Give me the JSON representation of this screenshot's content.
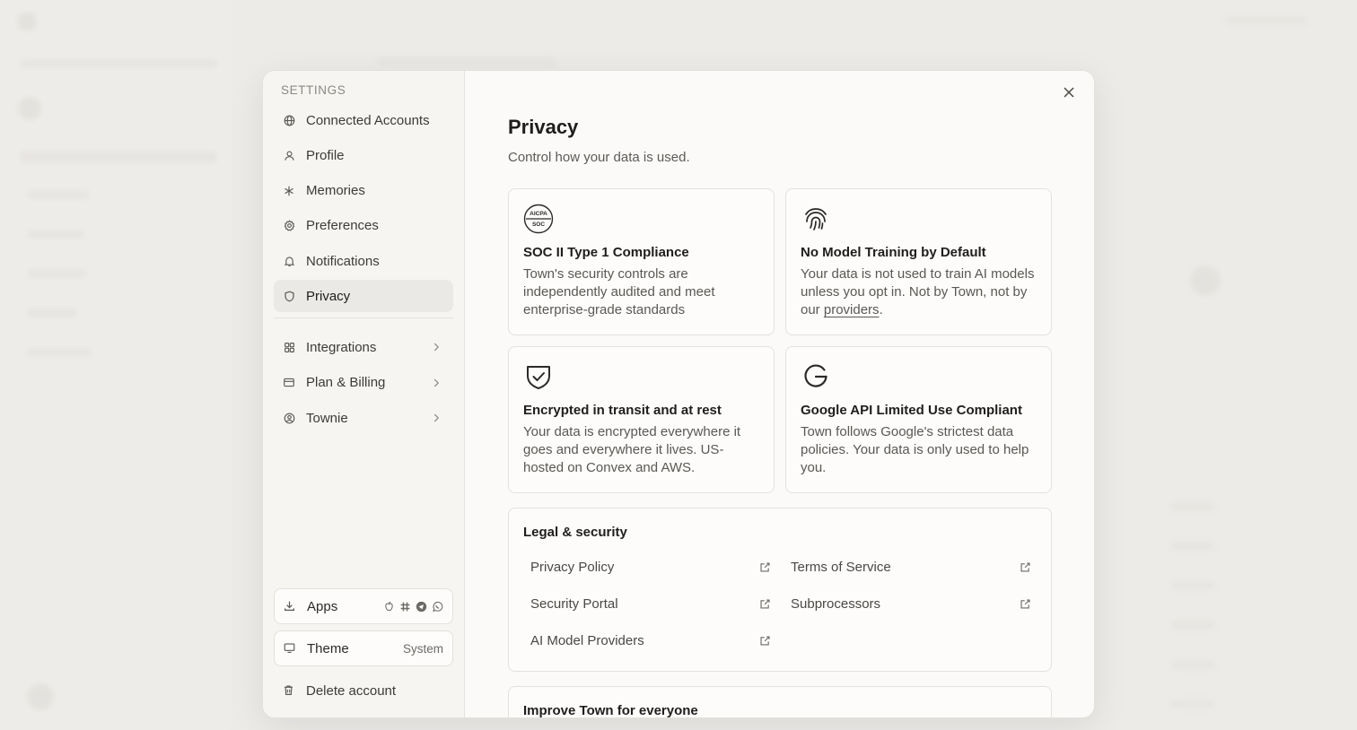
{
  "sidebar": {
    "heading": "SETTINGS",
    "items": [
      {
        "label": "Connected Accounts",
        "icon": "globe-icon"
      },
      {
        "label": "Profile",
        "icon": "user-icon"
      },
      {
        "label": "Memories",
        "icon": "asterisk-icon"
      },
      {
        "label": "Preferences",
        "icon": "gear-icon"
      },
      {
        "label": "Notifications",
        "icon": "bell-icon"
      },
      {
        "label": "Privacy",
        "icon": "shield-icon",
        "active": true
      }
    ],
    "expandable_items": [
      {
        "label": "Integrations",
        "icon": "grid-icon"
      },
      {
        "label": "Plan & Billing",
        "icon": "credit-card-icon"
      },
      {
        "label": "Townie",
        "icon": "user-circle-icon"
      }
    ],
    "apps_label": "Apps",
    "theme_label": "Theme",
    "theme_value": "System",
    "delete_label": "Delete account"
  },
  "main": {
    "title": "Privacy",
    "subtitle": "Control how your data is used.",
    "cards": [
      {
        "title": "SOC II Type 1 Compliance",
        "description": "Town's security controls are independently audited and meet enterprise-grade standards",
        "icon": "aicpa-soc-badge-icon",
        "badge_top": "AICPA",
        "badge_bottom": "SOC"
      },
      {
        "title": "No Model Training by Default",
        "description_before_link": "Your data is not used to train AI models unless you opt in. Not by Town, not by our ",
        "link_text": "providers",
        "description_after_link": ".",
        "icon": "fingerprint-icon"
      },
      {
        "title": "Encrypted in transit and at rest",
        "description": "Your data is encrypted everywhere it goes and everywhere it lives. US-hosted on Convex and AWS.",
        "icon": "shield-check-icon"
      },
      {
        "title": "Google API Limited Use Compliant",
        "description": "Town follows Google's strictest data policies. Your data is only used to help you.",
        "icon": "google-g-icon"
      }
    ],
    "legal": {
      "title": "Legal & security",
      "links": [
        "Privacy Policy",
        "Terms of Service",
        "Security Portal",
        "Subprocessors",
        "AI Model Providers"
      ]
    },
    "improve": {
      "title": "Improve Town for everyone"
    }
  },
  "colors": {
    "backdrop": "#ebeae6",
    "modal": "#fbfaf8",
    "sidebar": "#f6f5f2",
    "active_item": "#ebe9e5",
    "border": "#e3e1dc"
  }
}
